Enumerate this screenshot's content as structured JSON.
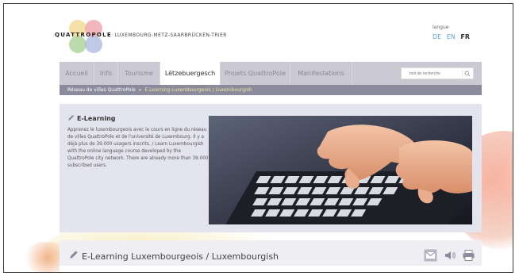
{
  "header": {
    "brand_name": "QUATTROPOLE",
    "brand_cities": "LUXEMBOURG-METZ-SAARBRÜCKEN-TRIER",
    "language_label": "langue",
    "languages": [
      {
        "code": "DE",
        "active": false
      },
      {
        "code": "EN",
        "active": false
      },
      {
        "code": "FR",
        "active": true
      }
    ]
  },
  "nav": {
    "tabs": [
      {
        "label": "Accueil",
        "active": false
      },
      {
        "label": "Info",
        "active": false
      },
      {
        "label": "Tourisme",
        "active": false
      },
      {
        "label": "Lëtzebuergesch",
        "active": true
      },
      {
        "label": "Projets QuattroPole",
        "active": false
      },
      {
        "label": "Manifestations",
        "active": false
      }
    ],
    "search_placeholder": "mot de recherche"
  },
  "breadcrumb": {
    "root": "Réseau de villes QuattroPole",
    "separator": "»",
    "current": "E-Learning Luxembourgeois / Luxembourgish"
  },
  "feature": {
    "title": "E-Learning",
    "text": "Apprenez le luxembourgeois avec le cours en ligne du réseau de villes QuattroPole et de l'université de Luxembourg. Il y a déjà plus de 39.000 usagers inscrits. / Learn Luxembourgish with the online language course developed by the QuattroPole city network. There are already more than 39.000 subscribed users.",
    "photo_subject": "hands typing on keyboard"
  },
  "article": {
    "title": "E-Learning Luxembourgeois / Luxembourgish",
    "actions": [
      "mail-icon",
      "speaker-icon",
      "print-icon"
    ]
  },
  "colors": {
    "nav_bg": "#c9c8d3",
    "breadcrumb_bg": "#8c8b9e",
    "feature_bg": "#e4e4ee",
    "link_blue": "#6aa0d8",
    "breadcrumb_current": "#f0e59a"
  }
}
